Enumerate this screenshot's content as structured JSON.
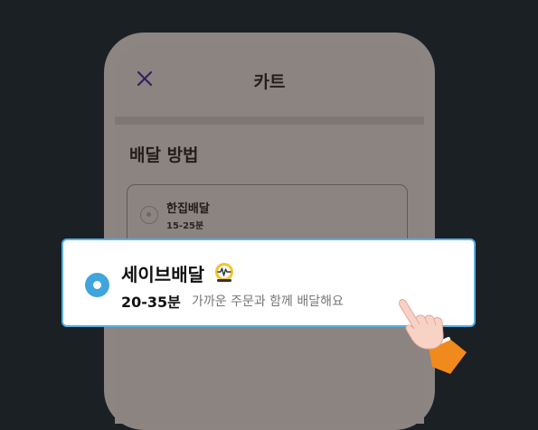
{
  "header": {
    "title": "카트",
    "close_icon": "close-icon"
  },
  "delivery": {
    "section_title": "배달 방법",
    "options": [
      {
        "name": "한집배달",
        "time": "15-25분",
        "selected": false
      },
      {
        "name": "세이브배달",
        "time": "20-35분",
        "description": "가까운 주문과 함께 배달해요",
        "icon": "save-delivery-badge-icon",
        "selected": true
      }
    ]
  },
  "colors": {
    "accent": "#3fa5dc",
    "highlight_border": "#56b0e6",
    "page_background": "#1b2024"
  }
}
